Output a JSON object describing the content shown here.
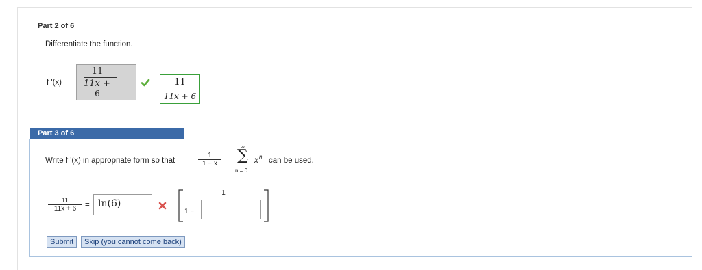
{
  "part2": {
    "label": "Part 2 of 6",
    "instruction": "Differentiate the function.",
    "lhs": "f '(x) =",
    "answer": {
      "num": "11",
      "den_top": "11x +",
      "den_bottom": "6"
    },
    "check_icon": "check-icon",
    "correct": {
      "num": "11",
      "den": "11x + 6"
    }
  },
  "part3": {
    "label": "Part 3 of 6",
    "instruction": "Write f '(x) in appropriate form so that",
    "series_frac": {
      "num": "1",
      "den": "1 − x"
    },
    "equals": "=",
    "sigma": {
      "top": "∞",
      "symbol": "∑",
      "bottom": "n = 0",
      "term_base": "x",
      "term_exp": "n"
    },
    "tail": "can be used.",
    "lhs": {
      "num": "11",
      "den": "11x + 6"
    },
    "answer_input": "ln(6)",
    "wrong_icon": "cross-icon",
    "bracket": {
      "num": "1",
      "den_prefix": "1 −",
      "den_input": ""
    },
    "buttons": {
      "submit": "Submit",
      "skip": "Skip (you cannot come back)"
    }
  },
  "colors": {
    "header_blue": "#3b6aa8",
    "check_green": "#5cae3a",
    "cross_red": "#d9534f",
    "panel_border": "#a9c3df"
  }
}
